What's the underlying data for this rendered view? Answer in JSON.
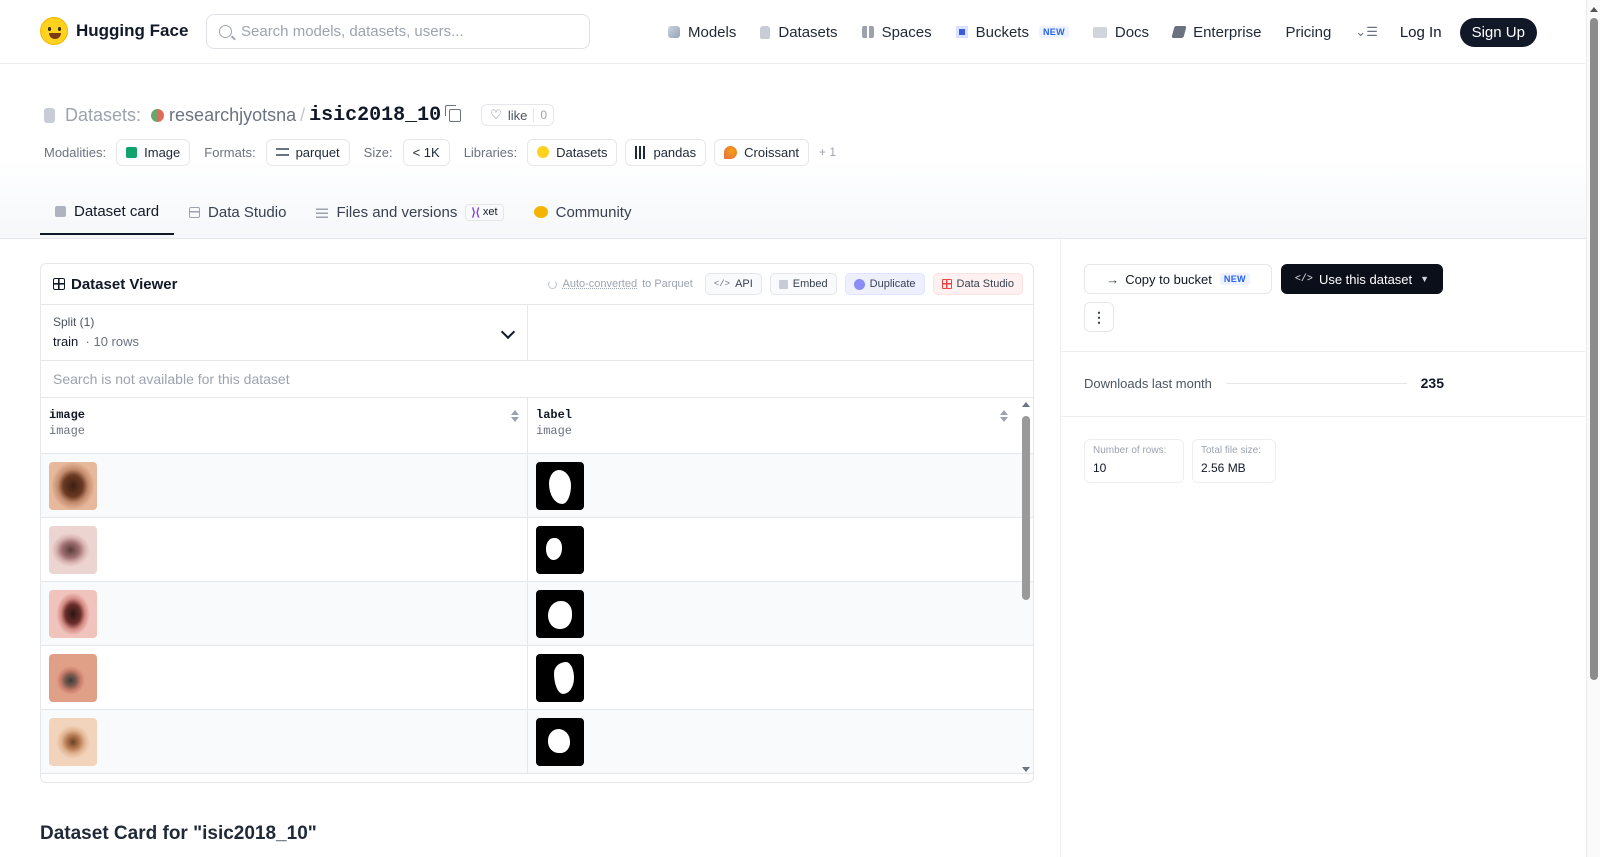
{
  "nav": {
    "logo_text": "Hugging Face",
    "search_placeholder": "Search models, datasets, users...",
    "links": {
      "models": "Models",
      "datasets": "Datasets",
      "spaces": "Spaces",
      "buckets": "Buckets",
      "buckets_badge": "NEW",
      "docs": "Docs",
      "enterprise": "Enterprise",
      "pricing": "Pricing"
    },
    "menu_icon": "menu-icon",
    "login": "Log In",
    "signup": "Sign Up"
  },
  "header": {
    "prefix": "Datasets:",
    "owner": "researchjyotsna",
    "separator": "/",
    "name": "isic2018_10",
    "like_label": "like",
    "like_count": "0",
    "meta": {
      "modalities_label": "Modalities:",
      "modality": "Image",
      "formats_label": "Formats:",
      "format": "parquet",
      "size_label": "Size:",
      "size": "< 1K",
      "libraries_label": "Libraries:",
      "libraries": [
        "Datasets",
        "pandas",
        "Croissant"
      ],
      "more_libraries": "+ 1"
    },
    "tabs": {
      "dataset_card": "Dataset card",
      "data_studio": "Data Studio",
      "files": "Files and versions",
      "xet": "xet",
      "community": "Community"
    }
  },
  "viewer": {
    "title": "Dataset Viewer",
    "auto_converted": "Auto-converted",
    "to_parquet": "to Parquet",
    "api": "API",
    "embed": "Embed",
    "duplicate": "Duplicate",
    "data_studio": "Data Studio",
    "split_label": "Split (1)",
    "split_value": "train",
    "split_rows": "· 10 rows",
    "search_note": "Search is not available for this dataset",
    "columns": [
      {
        "name": "image",
        "type": "image"
      },
      {
        "name": "label",
        "type": "image"
      }
    ],
    "rows": [
      {
        "image": "skin-lesion-image",
        "label": "segmentation-mask"
      },
      {
        "image": "skin-lesion-image",
        "label": "segmentation-mask"
      },
      {
        "image": "skin-lesion-image",
        "label": "segmentation-mask"
      },
      {
        "image": "skin-lesion-image",
        "label": "segmentation-mask"
      },
      {
        "image": "skin-lesion-image",
        "label": "segmentation-mask"
      }
    ]
  },
  "card_heading": "Dataset Card for \"isic2018_10\"",
  "sidebar": {
    "copy_to_bucket": "Copy to bucket",
    "copy_badge": "NEW",
    "use_dataset": "Use this dataset",
    "more": "⋮",
    "downloads_label": "Downloads last month",
    "downloads_value": "235",
    "rows_label": "Number of rows:",
    "rows_value": "10",
    "size_label": "Total file size:",
    "size_value": "2.56 MB"
  },
  "colors": {
    "accent_dark": "#0b0f19",
    "badge_blue": "#2563eb",
    "hf_yellow": "#FFD21E"
  }
}
